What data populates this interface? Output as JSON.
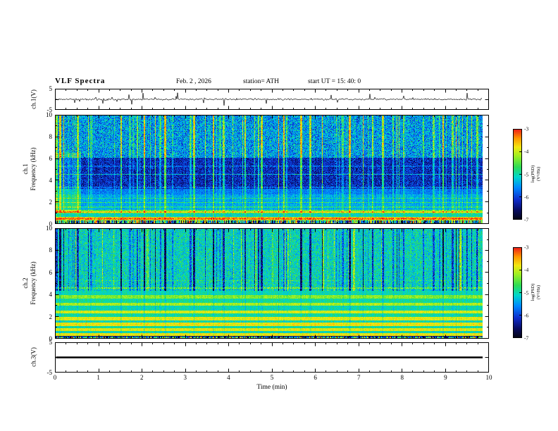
{
  "header": {
    "title": "VLF Spectra",
    "date": "Feb. 2  , 2026",
    "station": "station= ATH",
    "start_ut": "start UT =   15: 40: 0"
  },
  "x_axis": {
    "label": "Time (min)",
    "min": 0,
    "max": 10,
    "ticks": [
      "0",
      "1",
      "2",
      "3",
      "4",
      "5",
      "6",
      "7",
      "8",
      "9",
      "10"
    ]
  },
  "colorbar": {
    "label": "log(PSD)(V²/Hz)",
    "ticks": [
      "-3",
      "-4",
      "-5",
      "-6",
      "-7"
    ],
    "range": [
      -7,
      -3
    ]
  },
  "panels": {
    "ch1_wave": {
      "ylabel": "ch.1(V)",
      "yticks": [
        "5",
        "-5"
      ],
      "ylim": [
        -5,
        5
      ]
    },
    "ch1_spec": {
      "ylabel": "ch.1\nFrequency (kHz)",
      "yticks": [
        "10",
        "8",
        "6",
        "4",
        "2",
        "0"
      ],
      "ylim": [
        0,
        10
      ]
    },
    "ch2_spec": {
      "ylabel": "ch.2\nFrequency (kHz)",
      "yticks": [
        "10",
        "8",
        "6",
        "4",
        "2",
        "0"
      ],
      "ylim": [
        0,
        10
      ]
    },
    "ch3_wave": {
      "ylabel": "ch.3(V)",
      "yticks": [
        "5",
        "-5"
      ],
      "ylim": [
        -5,
        5
      ]
    }
  },
  "chart_data": [
    {
      "id": "ch1_wave",
      "type": "line",
      "title": "ch.1 raw signal (V)",
      "xlim": [
        0,
        10
      ],
      "ylim": [
        -5,
        5
      ],
      "xlabel": "Time (min)",
      "ylabel": "ch.1(V)",
      "description": "Broadband noise centred on 0 V (~±0.8 V) with frequent impulsive sferic spikes reaching about ±4 V; trace ends near 9.85 min.",
      "render": {
        "seed": 11,
        "noise_v": 0.4,
        "spike_prob": 0.05,
        "spike_min": 0.8,
        "spike_max": 3.6,
        "data_frac": 0.985
      }
    },
    {
      "id": "ch1_spec",
      "type": "heatmap",
      "title": "ch.1 VLF spectrogram",
      "xlim": [
        0,
        10
      ],
      "ylim": [
        0,
        10
      ],
      "xlabel": "Time (min)",
      "ylabel": "ch.1 Frequency (kHz)",
      "value_label": "log(PSD)(V²/Hz)",
      "value_range": [
        -7,
        -3
      ],
      "description": "Dark-blue quiet band 3-6 kHz, green speckled sferic streaks 6-10 kHz, cyan/green bands below 3 kHz, yellow-green line near 0.5 kHz, persistent yellow line near 4.6 kHz, colourful speckle below 0.3 kHz.",
      "render": {
        "seed": 42,
        "streak_seed": 77,
        "data_frac": 0.985,
        "f_max": 10,
        "noise": 0.14,
        "bands": [
          [
            0,
            0.28,
            0.1
          ],
          [
            0.28,
            0.6,
            0.72
          ],
          [
            0.6,
            0.95,
            0.48
          ],
          [
            0.95,
            1.25,
            0.62
          ],
          [
            1.25,
            2.7,
            0.4
          ],
          [
            2.7,
            3.2,
            0.34
          ],
          [
            3.2,
            6.1,
            0.2
          ],
          [
            6.1,
            10.01,
            0.38
          ]
        ],
        "lines": [
          [
            0.45,
            0.1,
            0.2
          ],
          [
            1.05,
            0.07,
            0.18
          ],
          [
            1.55,
            0.06,
            0.12
          ],
          [
            1.95,
            0.06,
            0.16
          ],
          [
            2.35,
            0.05,
            0.12
          ],
          [
            3.35,
            0.04,
            0.1
          ],
          [
            4.55,
            0.06,
            0.22
          ],
          [
            5.3,
            0.05,
            0.08
          ]
        ],
        "speckle_below": 0.26,
        "speckle_amp": 0.95,
        "extra_noise": [
          [
            3.2,
            6.1,
            0.18
          ],
          [
            6.1,
            10.01,
            0.3
          ]
        ],
        "streak_density": 0.16,
        "streak_min": 0.12,
        "streak_max": 0.45,
        "streak_profile": [
          [
            0,
            1,
            0.25
          ],
          [
            1,
            3.2,
            0.5
          ],
          [
            3.2,
            6.1,
            0.9
          ],
          [
            6.1,
            10.01,
            1.0
          ]
        ],
        "left_boost": {
          "frac": 0.06,
          "amp": 0.12,
          "fmin": 1.0,
          "fmax": 6.5
        }
      }
    },
    {
      "id": "ch2_spec",
      "type": "heatmap",
      "title": "ch.2 VLF spectrogram",
      "xlim": [
        0,
        10
      ],
      "ylim": [
        0,
        10
      ],
      "xlabel": "Time (min)",
      "ylabel": "ch.2 Frequency (kHz)",
      "value_label": "log(PSD)(V²/Hz)",
      "value_range": [
        -7,
        -3
      ],
      "description": "Strong stable yellow/green horizontal power-line-harmonic banding below ~4.3 kHz; above 4.3 kHz a green background crossed by dark-blue vertical sferic streaks.",
      "render": {
        "seed": 99,
        "streak_seed": 77,
        "data_frac": 0.985,
        "f_max": 10,
        "noise": 0.1,
        "bands": [
          [
            0,
            0.2,
            0.12
          ],
          [
            0.2,
            0.45,
            0.8
          ],
          [
            0.45,
            0.65,
            0.5
          ],
          [
            0.65,
            0.9,
            0.78
          ],
          [
            0.9,
            1.15,
            0.52
          ],
          [
            1.15,
            1.42,
            0.8
          ],
          [
            1.42,
            1.65,
            0.5
          ],
          [
            1.65,
            1.98,
            0.78
          ],
          [
            1.98,
            2.25,
            0.52
          ],
          [
            2.25,
            2.55,
            0.76
          ],
          [
            2.55,
            2.95,
            0.5
          ],
          [
            2.95,
            3.25,
            0.72
          ],
          [
            3.25,
            3.65,
            0.52
          ],
          [
            3.65,
            3.95,
            0.68
          ],
          [
            3.95,
            4.3,
            0.5
          ],
          [
            4.3,
            10.01,
            0.48
          ]
        ],
        "lines": [
          [
            4.6,
            0.06,
            0.15
          ],
          [
            5.25,
            0.05,
            0.08
          ]
        ],
        "speckle_below": 0.18,
        "speckle_amp": 0.85,
        "extra_noise": [
          [
            4.3,
            10.01,
            0.22
          ]
        ],
        "streak_density": 0.16,
        "streak_min": 0.12,
        "streak_max": 0.45,
        "streak_profile": [
          [
            0,
            4.3,
            -0.15
          ],
          [
            4.3,
            10.01,
            -0.9
          ]
        ],
        "bright_streaks": {
          "density": 0.05,
          "amp": 0.2,
          "fmin": 4.3
        }
      }
    },
    {
      "id": "ch3_wave",
      "type": "line",
      "title": "ch.3 raw signal (V)",
      "xlim": [
        0,
        10
      ],
      "ylim": [
        -5,
        5
      ],
      "xlabel": "Time (min)",
      "ylabel": "ch.3(V)",
      "description": "Flat (dead) channel: constant 0 V thick black trace ending near 9.85 min.",
      "render": {
        "value": 0,
        "line_width": 2.6,
        "data_frac": 0.985
      }
    }
  ]
}
